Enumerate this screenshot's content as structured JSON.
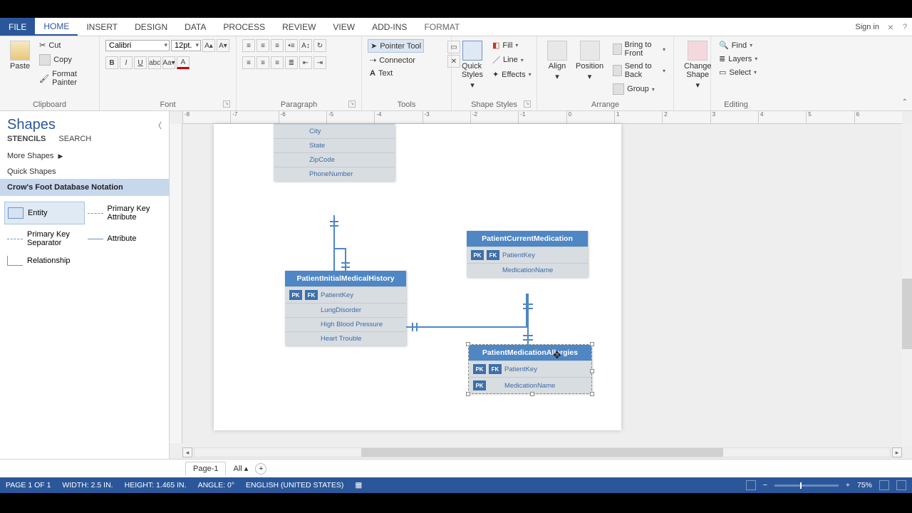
{
  "tabs": {
    "file": "FILE",
    "home": "HOME",
    "insert": "INSERT",
    "design": "DESIGN",
    "data": "DATA",
    "process": "PROCESS",
    "review": "REVIEW",
    "view": "VIEW",
    "addins": "ADD-INS",
    "format": "FORMAT"
  },
  "signin": "Sign in",
  "ribbon": {
    "clipboard": {
      "label": "Clipboard",
      "paste": "Paste",
      "cut": "Cut",
      "copy": "Copy",
      "format_painter": "Format Painter"
    },
    "font": {
      "label": "Font",
      "family": "Calibri",
      "size": "12pt."
    },
    "paragraph": {
      "label": "Paragraph"
    },
    "tools": {
      "label": "Tools",
      "pointer": "Pointer Tool",
      "connector": "Connector",
      "text": "Text"
    },
    "shape_styles": {
      "label": "Shape Styles",
      "quick_styles": "Quick Styles",
      "fill": "Fill",
      "line": "Line",
      "effects": "Effects"
    },
    "arrange": {
      "label": "Arrange",
      "align": "Align",
      "position": "Position",
      "bring_front": "Bring to Front",
      "send_back": "Send to Back",
      "group": "Group"
    },
    "change_shape": "Change Shape",
    "editing": {
      "label": "Editing",
      "find": "Find",
      "layers": "Layers",
      "select": "Select"
    }
  },
  "shapes_pane": {
    "title": "Shapes",
    "tab_stencils": "STENCILS",
    "tab_search": "SEARCH",
    "more_shapes": "More Shapes",
    "quick_shapes": "Quick Shapes",
    "stencil": "Crow's Foot Database Notation",
    "shape_entity": "Entity",
    "shape_pk_attr": "Primary Key Attribute",
    "shape_pk_sep": "Primary Key Separator",
    "shape_attr": "Attribute",
    "shape_rel": "Relationship"
  },
  "ruler_labels": [
    "-8",
    "-7",
    "-6",
    "-5",
    "-4",
    "-3",
    "-2",
    "-1",
    "0",
    "1",
    "2",
    "3",
    "4",
    "5",
    "6"
  ],
  "entities": {
    "top_partial": {
      "rows": [
        "City",
        "State",
        "ZipCode",
        "PhoneNumber"
      ]
    },
    "history": {
      "title": "PatientInitialMedicalHistory",
      "pk": "PatientKey",
      "rows": [
        "LungDisorder",
        "High Blood Pressure",
        "Heart Trouble"
      ]
    },
    "current_med": {
      "title": "PatientCurrentMedication",
      "pk": "PatientKey",
      "rows": [
        "MedicationName"
      ]
    },
    "allergies": {
      "title": "PatientMedicationAllergies",
      "pk": "PatientKey",
      "rows": [
        "MedicationName"
      ]
    }
  },
  "pk_label": "PK",
  "fk_label": "FK",
  "page_tabs": {
    "page1": "Page-1",
    "all": "All"
  },
  "status": {
    "page": "PAGE 1 OF 1",
    "width": "WIDTH: 2.5 IN.",
    "height": "HEIGHT: 1.465 IN.",
    "angle": "ANGLE: 0°",
    "lang": "ENGLISH (UNITED STATES)",
    "zoom": "75%"
  }
}
